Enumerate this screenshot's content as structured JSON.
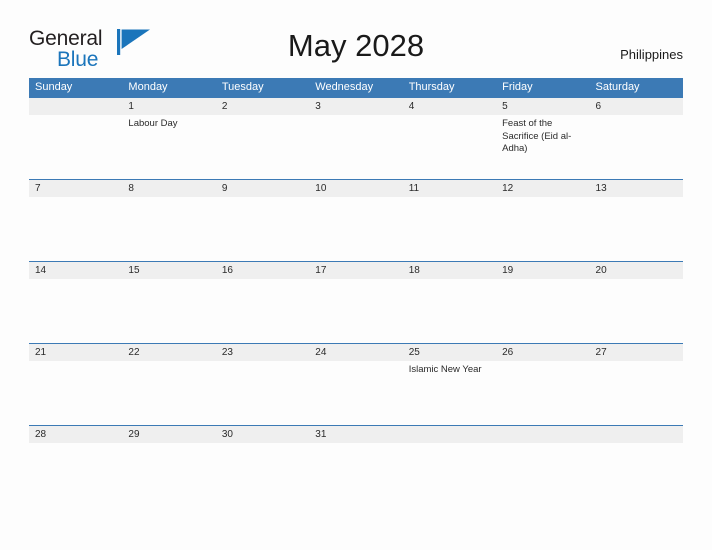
{
  "brand": {
    "name_part1": "General",
    "name_part2": "Blue",
    "flag_icon": "blue-flag-triangle-icon",
    "accent_color": "#1b75bb"
  },
  "header": {
    "title": "May 2028",
    "country": "Philippines"
  },
  "theme": {
    "header_blue": "#3c7ab5",
    "date_band_gray": "#efefef",
    "page_background": "#fdfdfd",
    "text_color": "#2a2a2a"
  },
  "calendar": {
    "weekdays": [
      "Sunday",
      "Monday",
      "Tuesday",
      "Wednesday",
      "Thursday",
      "Friday",
      "Saturday"
    ],
    "weeks": [
      {
        "days": [
          {
            "date": "",
            "event": ""
          },
          {
            "date": "1",
            "event": "Labour Day"
          },
          {
            "date": "2",
            "event": ""
          },
          {
            "date": "3",
            "event": ""
          },
          {
            "date": "4",
            "event": ""
          },
          {
            "date": "5",
            "event": "Feast of the Sacrifice (Eid al-Adha)"
          },
          {
            "date": "6",
            "event": ""
          }
        ]
      },
      {
        "days": [
          {
            "date": "7",
            "event": ""
          },
          {
            "date": "8",
            "event": ""
          },
          {
            "date": "9",
            "event": ""
          },
          {
            "date": "10",
            "event": ""
          },
          {
            "date": "11",
            "event": ""
          },
          {
            "date": "12",
            "event": ""
          },
          {
            "date": "13",
            "event": ""
          }
        ]
      },
      {
        "days": [
          {
            "date": "14",
            "event": ""
          },
          {
            "date": "15",
            "event": ""
          },
          {
            "date": "16",
            "event": ""
          },
          {
            "date": "17",
            "event": ""
          },
          {
            "date": "18",
            "event": ""
          },
          {
            "date": "19",
            "event": ""
          },
          {
            "date": "20",
            "event": ""
          }
        ]
      },
      {
        "days": [
          {
            "date": "21",
            "event": ""
          },
          {
            "date": "22",
            "event": ""
          },
          {
            "date": "23",
            "event": ""
          },
          {
            "date": "24",
            "event": ""
          },
          {
            "date": "25",
            "event": "Islamic New Year"
          },
          {
            "date": "26",
            "event": ""
          },
          {
            "date": "27",
            "event": ""
          }
        ]
      },
      {
        "days": [
          {
            "date": "28",
            "event": ""
          },
          {
            "date": "29",
            "event": ""
          },
          {
            "date": "30",
            "event": ""
          },
          {
            "date": "31",
            "event": ""
          },
          {
            "date": "",
            "event": ""
          },
          {
            "date": "",
            "event": ""
          },
          {
            "date": "",
            "event": ""
          }
        ]
      }
    ]
  }
}
